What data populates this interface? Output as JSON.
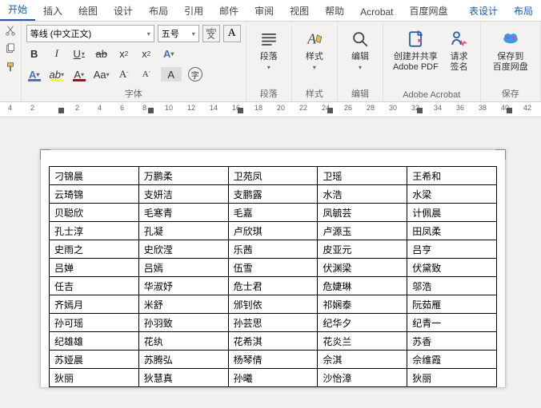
{
  "tabs": [
    "开始",
    "插入",
    "绘图",
    "设计",
    "布局",
    "引用",
    "邮件",
    "审阅",
    "视图",
    "帮助",
    "Acrobat",
    "百度网盘"
  ],
  "context_tabs": [
    "表设计",
    "布局"
  ],
  "font": {
    "name": "等线 (中文正文)",
    "size": "五号"
  },
  "groups": {
    "font": "字体",
    "para": "段落",
    "style": "样式",
    "edit": "编辑",
    "adobe": "Adobe Acrobat",
    "save": "保存"
  },
  "buttons": {
    "para": "段落",
    "style": "样式",
    "edit": "编辑",
    "adobe_create": "创建并共享\nAdobe PDF",
    "adobe_sign": "请求\n签名",
    "baidu_save": "保存到\n百度网盘"
  },
  "ruler_nums": [
    "4",
    "2",
    "",
    "2",
    "4",
    "6",
    "8",
    "10",
    "12",
    "14",
    "16",
    "18",
    "20",
    "22",
    "24",
    "26",
    "28",
    "30",
    "32",
    "34",
    "36",
    "38",
    "40",
    "42"
  ],
  "table": [
    [
      "刁锦晨",
      "万鹏柔",
      "卫苑凤",
      "卫瑶",
      "王希和"
    ],
    [
      "云琦锦",
      "支妍洁",
      "支鹏露",
      "水浩",
      "水梁"
    ],
    [
      "贝聪欣",
      "毛寒青",
      "毛嘉",
      "凤毓芸",
      "计佩晨"
    ],
    [
      "孔士淳",
      "孔凝",
      "卢欣琪",
      "卢源玉",
      "田凤柔"
    ],
    [
      "史雨之",
      "史欣滢",
      "乐茜",
      "皮亚元",
      "吕亨"
    ],
    [
      "吕婵",
      "吕嫣",
      "伍雪",
      "伏渊梁",
      "伏黛致"
    ],
    [
      "任吉",
      "华淑妤",
      "危士君",
      "危婕琳",
      "邬浩"
    ],
    [
      "齐嫣月",
      "米舒",
      "邠钊依",
      "祁娴泰",
      "阮茹雁"
    ],
    [
      "孙可瑶",
      "孙羽致",
      "孙芸思",
      "纪华夕",
      "纪青一"
    ],
    [
      "纪雄雄",
      "花纨",
      "花希淇",
      "花炎兰",
      "苏香"
    ],
    [
      "苏娅晨",
      "苏腾弘",
      "杨琴倩",
      "佘淇",
      "佘维霞"
    ],
    [
      "狄丽",
      "狄慧真",
      "孙曦",
      "沙怡漳",
      "狄丽"
    ]
  ]
}
